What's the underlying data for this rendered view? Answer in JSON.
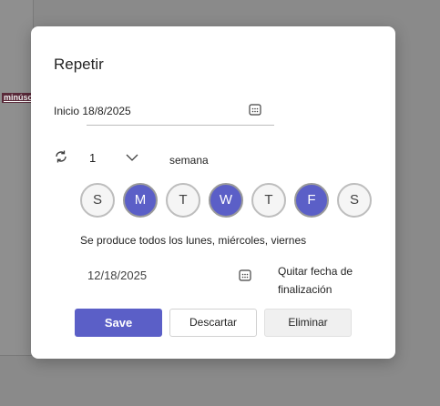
{
  "background": {
    "doc_fragment": "minúscul"
  },
  "dialog": {
    "title": "Repetir",
    "start": {
      "label": "Inicio 18/8/2025"
    },
    "interval": {
      "value": "1",
      "unit": "semana"
    },
    "days": [
      {
        "label": "S",
        "selected": false
      },
      {
        "label": "M",
        "selected": true
      },
      {
        "label": "T",
        "selected": false
      },
      {
        "label": "W",
        "selected": true
      },
      {
        "label": "T",
        "selected": false
      },
      {
        "label": "F",
        "selected": true
      },
      {
        "label": "S",
        "selected": false
      }
    ],
    "summary": "Se produce todos los lunes, miércoles, viernes",
    "end": {
      "date": "12/18/2025",
      "remove_label": "Quitar fecha de finalización"
    },
    "buttons": {
      "save": "Save",
      "discard": "Descartar",
      "delete": "Eliminar"
    }
  },
  "colors": {
    "accent": "#5b5fc7"
  }
}
